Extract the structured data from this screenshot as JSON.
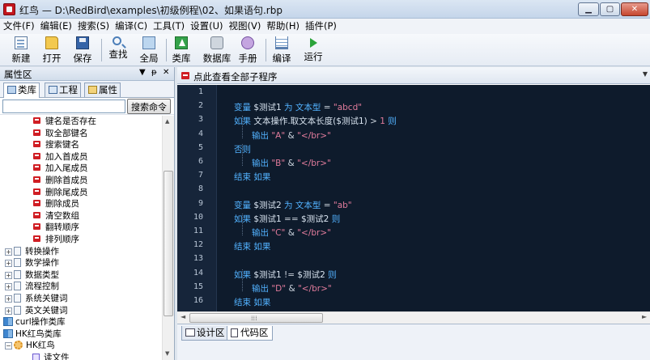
{
  "window": {
    "title": "红鸟 — D:\\RedBird\\examples\\初级例程\\02、如果语句.rbp"
  },
  "menu": [
    "文件(F)",
    "编辑(E)",
    "搜索(S)",
    "编译(C)",
    "工具(T)",
    "设置(U)",
    "视图(V)",
    "帮助(H)",
    "插件(P)"
  ],
  "toolbar": {
    "buttons": [
      {
        "label": "新建",
        "icon": "new-file-icon"
      },
      {
        "label": "打开",
        "icon": "folder-open-icon"
      },
      {
        "label": "保存",
        "icon": "floppy-disk-icon"
      },
      {
        "label": "查找",
        "icon": "magnifier-icon"
      },
      {
        "label": "全局",
        "icon": "window-icon"
      },
      {
        "label": "类库",
        "icon": "library-icon"
      },
      {
        "label": "数据库",
        "icon": "database-icon"
      },
      {
        "label": "手册",
        "icon": "manual-icon"
      },
      {
        "label": "编译",
        "icon": "compile-icon"
      },
      {
        "label": "运行",
        "icon": "play-icon"
      }
    ]
  },
  "left_panel": {
    "title": "属性区",
    "controls": [
      "▼",
      "ᵽ",
      "✕"
    ],
    "tabs": [
      "类库",
      "工程",
      "属性"
    ],
    "search": {
      "value": "",
      "button": "搜索命令"
    },
    "tree": [
      {
        "label": "键名是否存在",
        "kind": "function",
        "indent": 40
      },
      {
        "label": "取全部键名",
        "kind": "function",
        "indent": 40
      },
      {
        "label": "搜索键名",
        "kind": "function",
        "indent": 40
      },
      {
        "label": "加入首成员",
        "kind": "function",
        "indent": 40
      },
      {
        "label": "加入尾成员",
        "kind": "function",
        "indent": 40
      },
      {
        "label": "删除首成员",
        "kind": "function",
        "indent": 40
      },
      {
        "label": "删除尾成员",
        "kind": "function",
        "indent": 40
      },
      {
        "label": "删除成员",
        "kind": "function",
        "indent": 40
      },
      {
        "label": "清空数组",
        "kind": "function",
        "indent": 40
      },
      {
        "label": "翻转顺序",
        "kind": "function",
        "indent": 40
      },
      {
        "label": "排列顺序",
        "kind": "function",
        "indent": 40
      },
      {
        "label": "转换操作",
        "kind": "category",
        "indent": 6
      },
      {
        "label": "数学操作",
        "kind": "category",
        "indent": 6
      },
      {
        "label": "数据类型",
        "kind": "category",
        "indent": 6
      },
      {
        "label": "流程控制",
        "kind": "category",
        "indent": 6
      },
      {
        "label": "系统关键词",
        "kind": "category",
        "indent": 6
      },
      {
        "label": "英文关键词",
        "kind": "category",
        "indent": 6
      },
      {
        "label": "curl操作类库",
        "kind": "library",
        "indent": 4
      },
      {
        "label": "HK红鸟类库",
        "kind": "library",
        "indent": 4
      },
      {
        "label": "HK红鸟",
        "kind": "gear",
        "indent": 6
      },
      {
        "label": "读文件",
        "kind": "file",
        "indent": 40
      }
    ]
  },
  "editor": {
    "dropdown": "点此查看全部子程序",
    "line_numbers": [
      "1",
      "2",
      "3",
      "4",
      "5",
      "6",
      "7",
      "8",
      "9",
      "10",
      "11",
      "12",
      "13",
      "14",
      "15",
      "16"
    ],
    "lines": [
      {
        "indent": 0,
        "tokens": []
      },
      {
        "indent": 1,
        "tokens": [
          [
            "kw",
            "变量 "
          ],
          [
            "id",
            "$测试1 "
          ],
          [
            "kw",
            "为 文本型"
          ],
          [
            "op",
            " = "
          ],
          [
            "str",
            "\"abcd\""
          ]
        ]
      },
      {
        "indent": 1,
        "tokens": [
          [
            "kw",
            "如果 "
          ],
          [
            "id",
            "文本操作.取文本长度($测试1) "
          ],
          [
            "op",
            "> "
          ],
          [
            "str",
            "1 "
          ],
          [
            "kw",
            "则"
          ]
        ]
      },
      {
        "indent": 2,
        "tokens": [
          [
            "kw",
            "输出 "
          ],
          [
            "str",
            "\"A\" "
          ],
          [
            "op",
            "& "
          ],
          [
            "str",
            "\"</br>\""
          ]
        ]
      },
      {
        "indent": 1,
        "tokens": [
          [
            "kw",
            "否则"
          ]
        ]
      },
      {
        "indent": 2,
        "tokens": [
          [
            "kw",
            "输出 "
          ],
          [
            "str",
            "\"B\" "
          ],
          [
            "op",
            "& "
          ],
          [
            "str",
            "\"</br>\""
          ]
        ]
      },
      {
        "indent": 1,
        "tokens": [
          [
            "kw",
            "结束 如果"
          ]
        ]
      },
      {
        "indent": 0,
        "tokens": []
      },
      {
        "indent": 1,
        "tokens": [
          [
            "kw",
            "变量 "
          ],
          [
            "id",
            "$测试2 "
          ],
          [
            "kw",
            "为 文本型"
          ],
          [
            "op",
            " = "
          ],
          [
            "str",
            "\"ab\""
          ]
        ]
      },
      {
        "indent": 1,
        "tokens": [
          [
            "kw",
            "如果 "
          ],
          [
            "id",
            "$测试1 "
          ],
          [
            "op",
            "== "
          ],
          [
            "id",
            "$测试2 "
          ],
          [
            "kw",
            "则"
          ]
        ]
      },
      {
        "indent": 2,
        "tokens": [
          [
            "kw",
            "输出 "
          ],
          [
            "str",
            "\"C\" "
          ],
          [
            "op",
            "& "
          ],
          [
            "str",
            "\"</br>\""
          ]
        ]
      },
      {
        "indent": 1,
        "tokens": [
          [
            "kw",
            "结束 如果"
          ]
        ]
      },
      {
        "indent": 0,
        "tokens": []
      },
      {
        "indent": 1,
        "tokens": [
          [
            "kw",
            "如果 "
          ],
          [
            "id",
            "$测试1 "
          ],
          [
            "op",
            "!= "
          ],
          [
            "id",
            "$测试2 "
          ],
          [
            "kw",
            "则"
          ]
        ]
      },
      {
        "indent": 2,
        "tokens": [
          [
            "kw",
            "输出 "
          ],
          [
            "str",
            "\"D\" "
          ],
          [
            "op",
            "& "
          ],
          [
            "str",
            "\"</br>\""
          ]
        ]
      },
      {
        "indent": 1,
        "tokens": [
          [
            "kw",
            "结束 如果"
          ]
        ]
      }
    ],
    "bottom_tabs": [
      "设计区",
      "代码区"
    ],
    "active_tab": "代码区"
  },
  "colors": {
    "code_bg": "#0e1b2c",
    "keyword": "#52b2ff",
    "string": "#e07b9b",
    "identifier": "#d9e4f0",
    "accent_red": "#d01e24"
  }
}
